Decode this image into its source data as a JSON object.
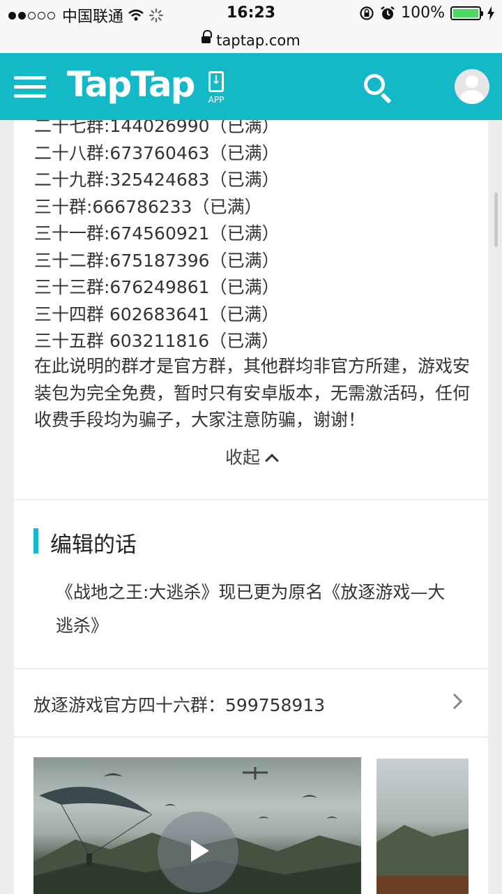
{
  "status_bar": {
    "carrier": "中国联通",
    "time": "16:23",
    "battery": "100%"
  },
  "url_bar": {
    "domain": "taptap.com"
  },
  "header": {
    "logo": "TapTap",
    "app_label": "APP"
  },
  "groups": [
    "二十七群:144026990（已满）",
    "二十八群:673760463（已满）",
    "二十九群:325424683（已满）",
    "三十群:666786233（已满）",
    "三十一群:674560921（已满）",
    "三十二群:675187396（已满）",
    "三十三群:676249861（已满）",
    "三十四群 602683641（已满）",
    "三十五群 603211816（已满）"
  ],
  "notice": "在此说明的群才是官方群，其他群均非官方所建，游戏安装包为完全免费，暂时只有安卓版本，无需激活码，任何收费手段均为骗子，大家注意防骗，谢谢！",
  "collapse_label": "收起",
  "editor": {
    "title": "编辑的话",
    "text": "《战地之王:大逃杀》现已更为原名《放逐游戏—大逃杀》"
  },
  "official_group": "放逐游戏官方四十六群：599758913"
}
